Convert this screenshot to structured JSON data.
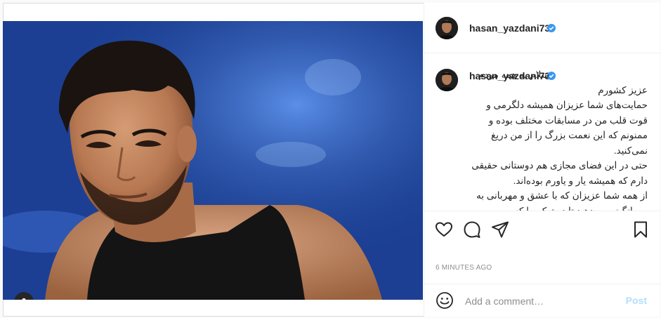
{
  "post": {
    "username": "hasan_yazdani73",
    "verified": true,
    "timestamp": "6 MINUTES AGO"
  },
  "caption": {
    "username": "hasan_yazdani73",
    "text": "سلام به همه مردم عزیز کشورم\nحمایت‌های شما عزیزان همیشه دلگرمی و قوت قلب من در مسابقات مختلف بوده و ممنونم که این نعمت بزرگ را از من دریغ نمی‌کنید.\nحتی در این فضای مجازی هم دوستانی حقیقی دارم که همیشه یار و یاورم بوده‌اند.\nاز همه شما عزیزان که با عشق و مهربانی به من انگیزه می‌دهید تا در توکیو با کسب"
  },
  "icons": {
    "like": "heart-icon",
    "comment": "comment-icon",
    "share": "paper-plane-icon",
    "save": "bookmark-icon",
    "emoji": "smiley-icon",
    "tags": "user-tag-icon",
    "verified": "verified-badge-icon"
  },
  "comment_box": {
    "placeholder": "Add a comment…",
    "post_label": "Post"
  },
  "colors": {
    "verified_blue": "#3897f0",
    "post_button": "#b2dffc",
    "muted_text": "#8e8e8e"
  }
}
